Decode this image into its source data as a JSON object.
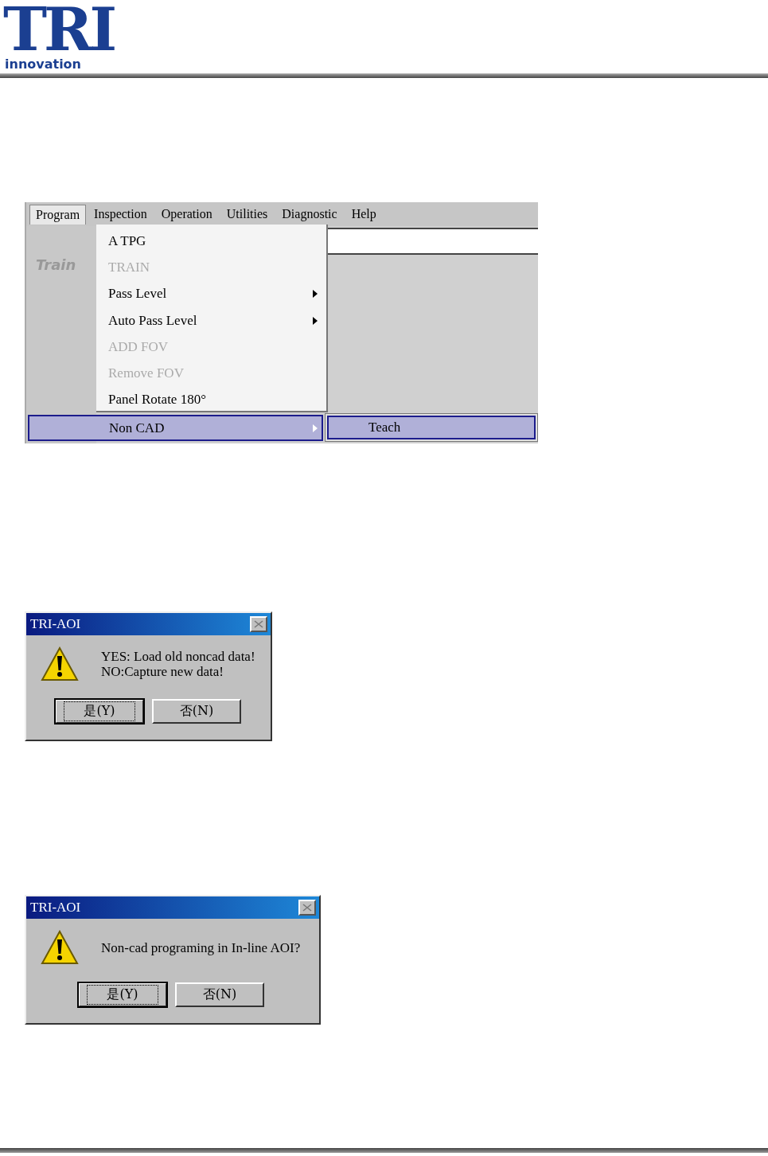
{
  "header": {
    "logo_mark": "TRI",
    "logo_word": "innovation"
  },
  "app_window": {
    "menu_bar": [
      {
        "label": "Program",
        "selected": true
      },
      {
        "label": "Inspection",
        "selected": false
      },
      {
        "label": "Operation",
        "selected": false
      },
      {
        "label": "Utilities",
        "selected": false
      },
      {
        "label": "Diagnostic",
        "selected": false
      },
      {
        "label": "Help",
        "selected": false
      }
    ],
    "side_label": "Train",
    "menu": [
      {
        "label": "A TPG",
        "disabled": false,
        "submenu": false,
        "selected": false
      },
      {
        "label": "TRAIN",
        "disabled": true,
        "submenu": false,
        "selected": false
      },
      {
        "label": "Pass Level",
        "disabled": false,
        "submenu": true,
        "selected": false
      },
      {
        "label": "Auto Pass Level",
        "disabled": false,
        "submenu": true,
        "selected": false
      },
      {
        "label": "ADD FOV",
        "disabled": true,
        "submenu": false,
        "selected": false
      },
      {
        "label": "Remove FOV",
        "disabled": true,
        "submenu": false,
        "selected": false
      },
      {
        "label": "Panel Rotate 180°",
        "disabled": false,
        "submenu": false,
        "selected": false
      },
      {
        "label": "Non CAD",
        "disabled": false,
        "submenu": true,
        "selected": true
      }
    ],
    "submenu": [
      {
        "label": "Teach",
        "selected": true
      }
    ]
  },
  "dialogs": [
    {
      "title": "TRI-AOI",
      "message": [
        "YES: Load old noncad data!",
        "NO:Capture new data!"
      ],
      "buttons": [
        {
          "label": "是(Y)",
          "selected": true
        },
        {
          "label": "否(N)",
          "selected": false
        }
      ]
    },
    {
      "title": "TRI-AOI",
      "message": [
        "Non-cad programing in In-line AOI?"
      ],
      "buttons": [
        {
          "label": "是(Y)",
          "selected": true
        },
        {
          "label": "否(N)",
          "selected": false
        }
      ]
    }
  ]
}
